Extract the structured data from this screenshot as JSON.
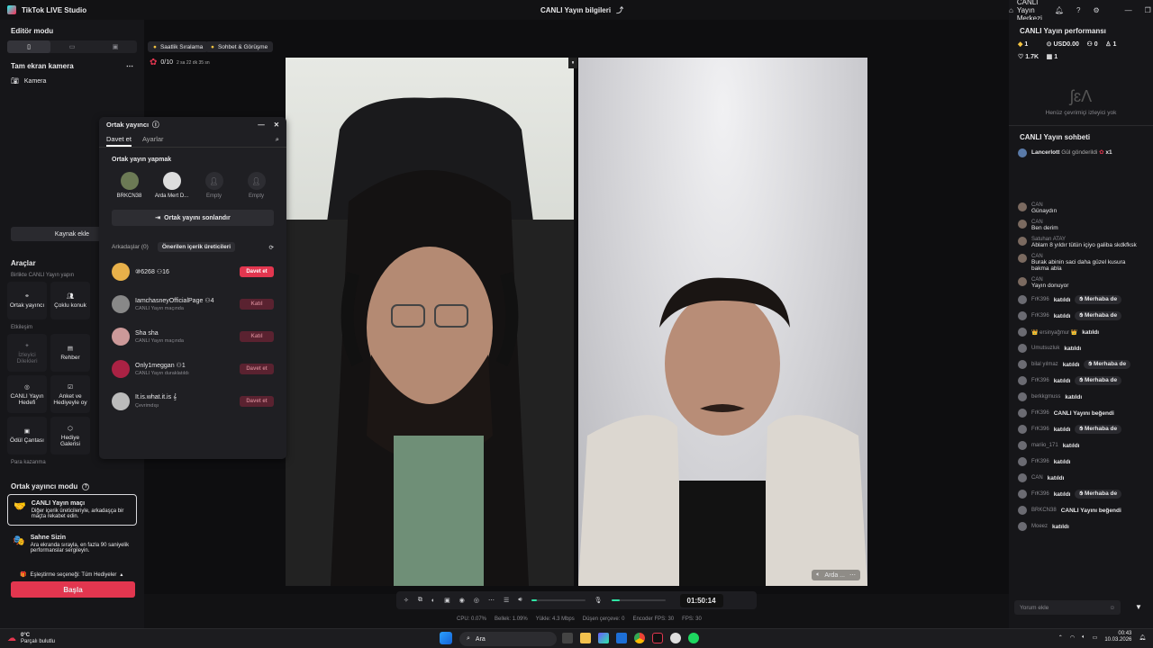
{
  "app": {
    "title": "TikTok LIVE Studio",
    "center_title": "CANLI Yayın bilgileri",
    "live_center": "CANLI Yayın Merkezi"
  },
  "left": {
    "editor_mode": "Editör modu",
    "scene": "Tam ekran kamera",
    "source": "Kamera",
    "add_source": "Kaynak ekle",
    "tools_title": "Araçlar",
    "together_label": "Birlikte CANLI Yayın yapın",
    "interaction_label": "Etkileşim",
    "earn_label": "Para kazanma",
    "tools": [
      {
        "label": "Ortak yayıncı",
        "icon": "co-host-icon",
        "dim": false
      },
      {
        "label": "Çoklu konuk",
        "icon": "multi-guest-icon",
        "dim": false
      },
      {
        "label": "İzleyici Dilekleri",
        "icon": "viewer-wishes-icon",
        "dim": true
      },
      {
        "label": "Rehber",
        "icon": "guide-icon",
        "dim": false
      },
      {
        "label": "CANLI Yayın Hedefi",
        "icon": "live-goal-icon",
        "dim": false
      },
      {
        "label": "Anket ve Hediyeyle oy",
        "icon": "poll-icon",
        "dim": false
      },
      {
        "label": "Ödül Çantası",
        "icon": "treasure-box-icon",
        "dim": false
      },
      {
        "label": "Hediye Galerisi",
        "icon": "gift-gallery-icon",
        "dim": false
      }
    ],
    "cohost_mode": "Ortak yayıncı modu",
    "cards": [
      {
        "title": "CANLI Yayın maçı",
        "desc": "Diğer içerik üreticileriyle, arkadaşça bir maçta rekabet edin."
      },
      {
        "title": "Sahne Sizin",
        "desc": "Ara ekranda sırayla, en fazla 90 saniyelik performanslar sergileyin."
      }
    ],
    "matching": "Eşleştirme seçeneği: Tüm Hediyeler",
    "start": "Başla"
  },
  "stage": {
    "chip1": "Saatlik Sıralama",
    "chip2": "Sohbet & Görüşme",
    "goal": "0/10",
    "timer_small": "2 sa 22 dk 35 sn",
    "cam_label": "Arda ...",
    "timer": "01:50:14",
    "stats": [
      "CPU: 0.07%",
      "Bellek: 1.09%",
      "Yükle: 4.3 Mbps",
      "Düşen çerçeve: 0",
      "Encoder FPS: 30",
      "FPS: 30"
    ],
    "mic_level": 0.15,
    "speaker_level": 0.1
  },
  "modal": {
    "title": "Ortak yayıncı",
    "tab_invite": "Davet et",
    "tab_settings": "Ayarlar",
    "section": "Ortak yayın yapmak",
    "seats": [
      "BRKCN38",
      "Arda Mert D...",
      "Empty",
      "Empty"
    ],
    "end": "Ortak yayını sonlandır",
    "friends": "Arkadaşlar (0)",
    "suggested": "Önerilen içerik üreticileri",
    "list": [
      {
        "name": "⑩⁣6268",
        "count": "16",
        "sub": "",
        "btn": "Davet et",
        "active": true
      },
      {
        "name": "IamchasneyOfficialPage",
        "count": "4",
        "sub": "CANLI Yayın maçında",
        "btn": "Katıl",
        "active": false
      },
      {
        "name": "Sha sha",
        "count": "",
        "sub": "CANLI Yayın maçında",
        "btn": "Katıl",
        "active": false
      },
      {
        "name": "Only1meggan",
        "count": "1",
        "sub": "CANLI Yayın duraklatıldı",
        "btn": "Davet et",
        "active": false
      },
      {
        "name": "It.is.what.it.is 𝄞",
        "count": "",
        "sub": "Çevrimdışı",
        "btn": "Davet et",
        "active": false
      }
    ]
  },
  "right": {
    "perf_title": "CANLI Yayın performansı",
    "perf": {
      "diamonds": "1",
      "usd": "USD0.00",
      "people": "0",
      "viewers": "1",
      "likes": "1.7K",
      "shares": "1"
    },
    "no_viewers": "Henüz çevrimiçi izleyici yok",
    "chat_title": "CANLI Yayın sohbeti",
    "gift_user": "Lancerlott",
    "gift_text": "Gül gönderildi",
    "gift_count": "x1",
    "messages": [
      {
        "user": "CAN",
        "text": "Günaydın"
      },
      {
        "user": "CAN",
        "text": "Ben derim"
      },
      {
        "user": "Satuhan ATAY",
        "text": "Ablam 8 yıldır tütün içiyo galiba skdkfksk"
      },
      {
        "user": "CAN",
        "text": "Burak abinin saci daha güzel kusura bakma abla"
      },
      {
        "user": "CAN",
        "text": "Yayın donuyor"
      }
    ],
    "events": [
      {
        "user": "FrK396",
        "text": "katıldı",
        "pill": "Merhaba de"
      },
      {
        "user": "FrK396",
        "text": "katıldı",
        "pill": "Merhaba de"
      },
      {
        "user": "👑 ersinyağmur 👑",
        "text": "katıldı",
        "pill": ""
      },
      {
        "user": "Umutsuzluk",
        "text": "katıldı",
        "pill": ""
      },
      {
        "user": "bilal yılmaz",
        "text": "katıldı",
        "pill": "Merhaba de"
      },
      {
        "user": "FrK396",
        "text": "katıldı",
        "pill": "Merhaba de"
      },
      {
        "user": "berkkgmuss",
        "text": "katıldı",
        "pill": ""
      },
      {
        "user": "FrK396",
        "text": "CANLI Yayını beğendi",
        "pill": ""
      },
      {
        "user": "FrK396",
        "text": "katıldı",
        "pill": "Merhaba de"
      },
      {
        "user": "mariio_171",
        "text": "katıldı",
        "pill": ""
      },
      {
        "user": "FrK396",
        "text": "katıldı",
        "pill": ""
      },
      {
        "user": "CAN",
        "text": "katıldı",
        "pill": ""
      },
      {
        "user": "FrK396",
        "text": "katıldı",
        "pill": "Merhaba de"
      },
      {
        "user": "BRKCN38",
        "text": "CANLI Yayını beğendi",
        "pill": ""
      },
      {
        "user": "Moeez",
        "text": "katıldı",
        "pill": ""
      }
    ],
    "comment_placeholder": "Yorum ekle"
  },
  "taskbar": {
    "weather_temp": "0°C",
    "weather_desc": "Parçalı bulutlu",
    "search": "Ara",
    "time": "00:43",
    "date": "10.03.2026"
  }
}
